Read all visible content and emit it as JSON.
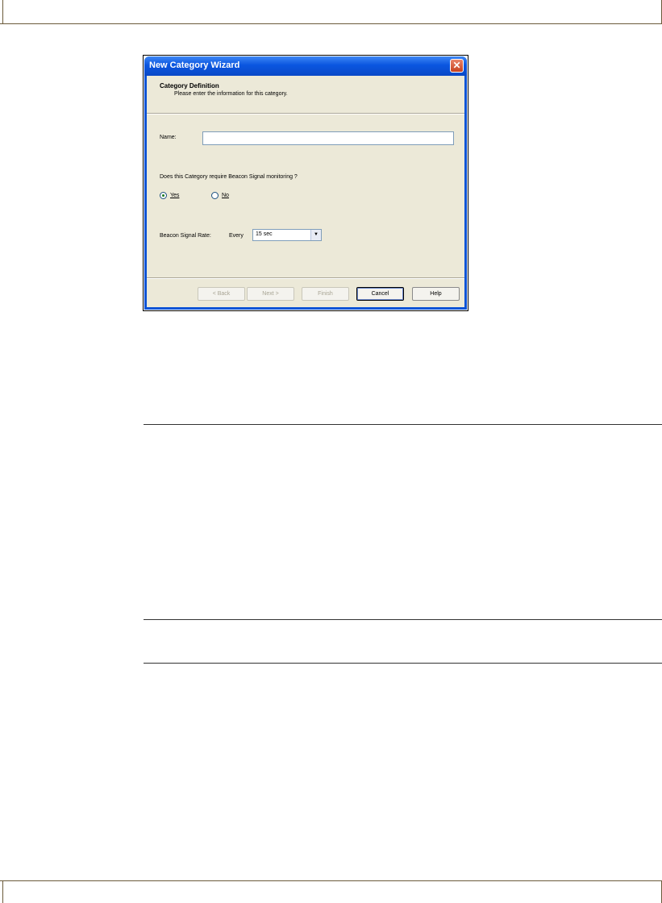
{
  "window": {
    "title": "New Category Wizard",
    "close_glyph": "✕"
  },
  "header": {
    "heading": "Category Definition",
    "subheading": "Please enter the information for this category."
  },
  "form": {
    "name_label": "Name:",
    "name_value": "",
    "question": "Does this Category require Beacon Signal monitoring ?",
    "radio_yes": "Yes",
    "radio_no": "No",
    "selected_option": "Yes",
    "rate_label": "Beacon Signal Rate:",
    "every_label": "Every",
    "rate_value": "15 sec",
    "dropdown_glyph": "▼"
  },
  "buttons": {
    "back": "< Back",
    "next": "Next >",
    "finish": "Finish",
    "cancel": "Cancel",
    "help": "Help"
  },
  "colors": {
    "titlebar": "#0a56e0",
    "dialog_face": "#ece9d8",
    "page_rule": "#6b5a3a"
  }
}
